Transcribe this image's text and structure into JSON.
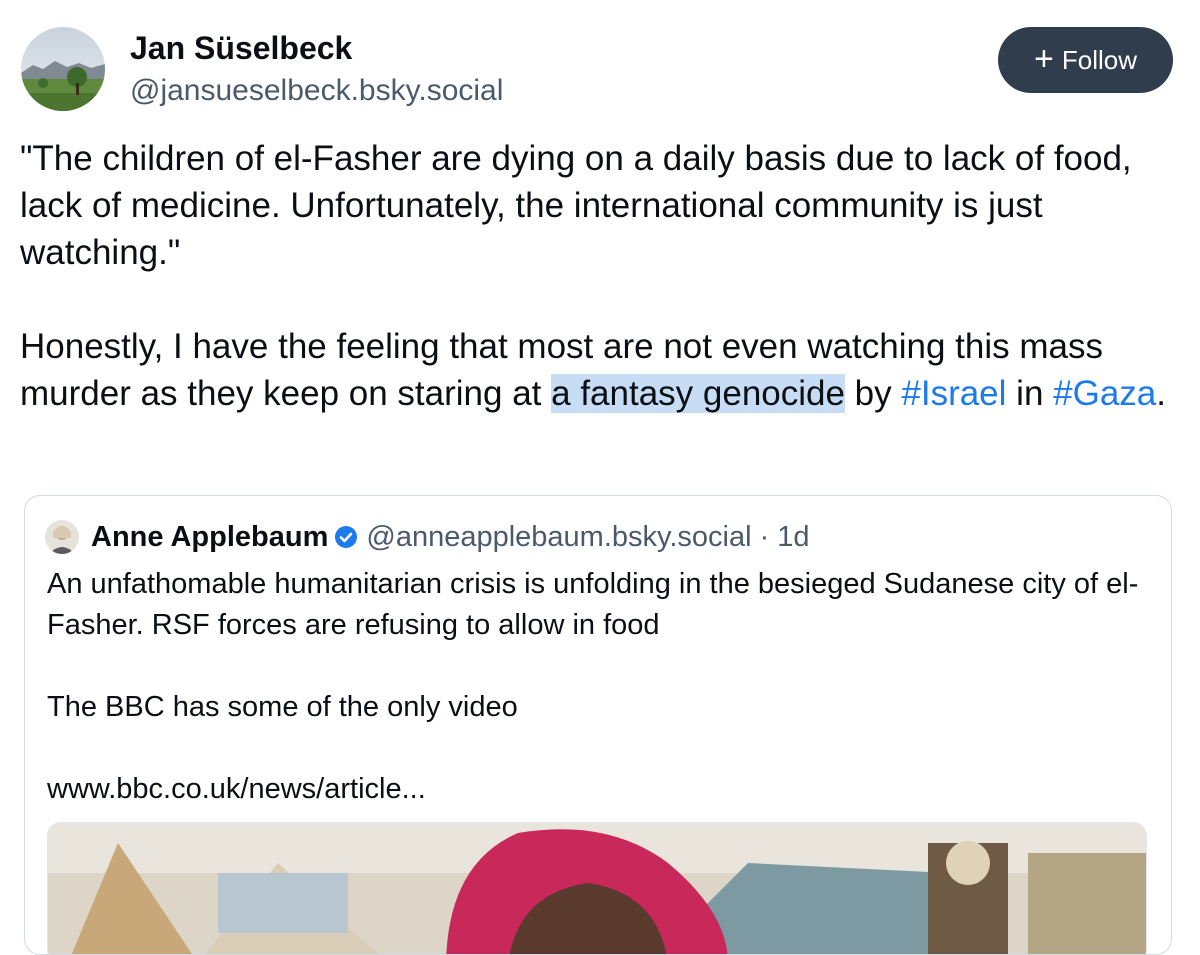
{
  "post": {
    "author": {
      "name": "Jan Süselbeck",
      "handle": "@jansueselbeck.bsky.social"
    },
    "follow_label": "Follow",
    "paragraph1": "\"The children of el-Fasher are dying on a daily basis due to lack of food, lack of medicine. Unfortunately, the international community is just watching.\"",
    "paragraph2": {
      "part1": "Honestly, I have the feeling that most are not even watching this mass murder as they keep on staring at ",
      "highlight": "a fantasy genocide",
      "part2": " by ",
      "tag1": "#Israel",
      "part3": " in ",
      "tag2": "#Gaza",
      "part4": "."
    }
  },
  "quote": {
    "author_name": "Anne Applebaum",
    "handle": "@anneapplebaum.bsky.social",
    "separator": "·",
    "time": "1d",
    "line1": "An unfathomable humanitarian crisis is unfolding in the besieged Sudanese city of el-Fasher. RSF forces are refusing to allow in food",
    "line2": "The BBC has some of the only video",
    "link": "www.bbc.co.uk/news/article..."
  },
  "colors": {
    "link": "#1d7aeb",
    "highlight": "#c7ddf6",
    "follow_bg": "#2f3d4c",
    "verified": "#1d7aeb",
    "muted": "#4b5a6a"
  },
  "icons": {
    "follow": "plus-icon",
    "verified": "verified-check-icon"
  }
}
